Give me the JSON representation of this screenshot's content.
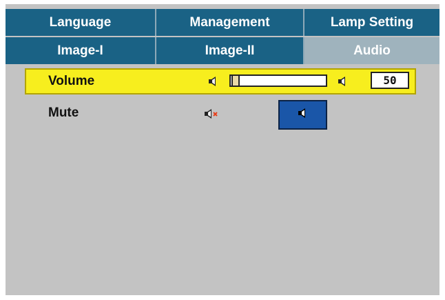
{
  "tabs_row1": [
    {
      "label": "Language"
    },
    {
      "label": "Management"
    },
    {
      "label": "Lamp Setting"
    }
  ],
  "tabs_row2": [
    {
      "label": "Image-I"
    },
    {
      "label": "Image-II"
    },
    {
      "label": "Audio",
      "active": true
    }
  ],
  "volume": {
    "label": "Volume",
    "value": "50",
    "icons": [
      "speaker-low-icon",
      "speaker-high-icon"
    ]
  },
  "mute": {
    "label": "Mute",
    "indicator_icon": "speaker-muted-icon",
    "button_icon": "speaker-icon"
  },
  "colors": {
    "tab_bg": "#1a6285",
    "tab_active_bg": "#9fb3bd",
    "panel_bg": "#c3c3c3",
    "highlight": "#f7ee1e",
    "button_blue": "#1a56a8"
  }
}
